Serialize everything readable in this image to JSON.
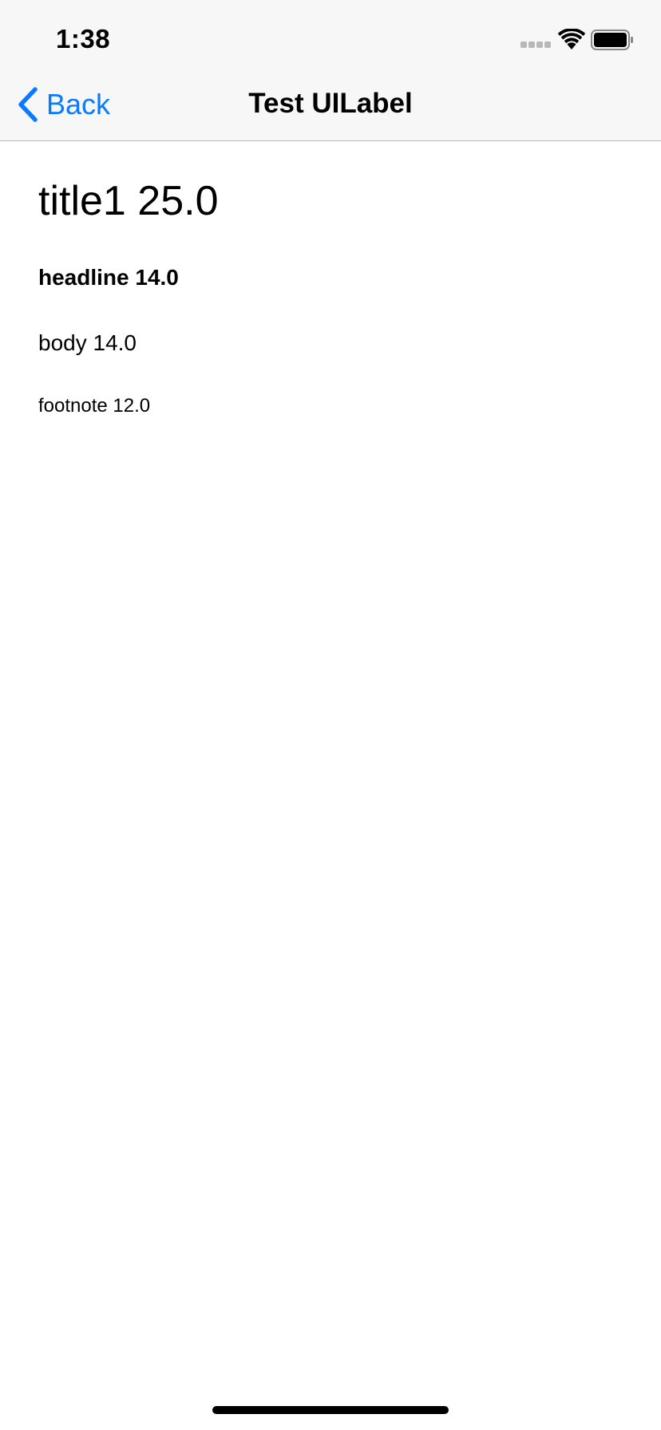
{
  "status_bar": {
    "time": "1:38"
  },
  "nav_bar": {
    "back_label": "Back",
    "title": "Test UILabel",
    "back_icon": "chevron-left-icon",
    "accent_color": "#0a7aff"
  },
  "labels": {
    "title1": "title1 25.0",
    "headline": "headline 14.0",
    "body": "body 14.0",
    "footnote": "footnote 12.0"
  }
}
